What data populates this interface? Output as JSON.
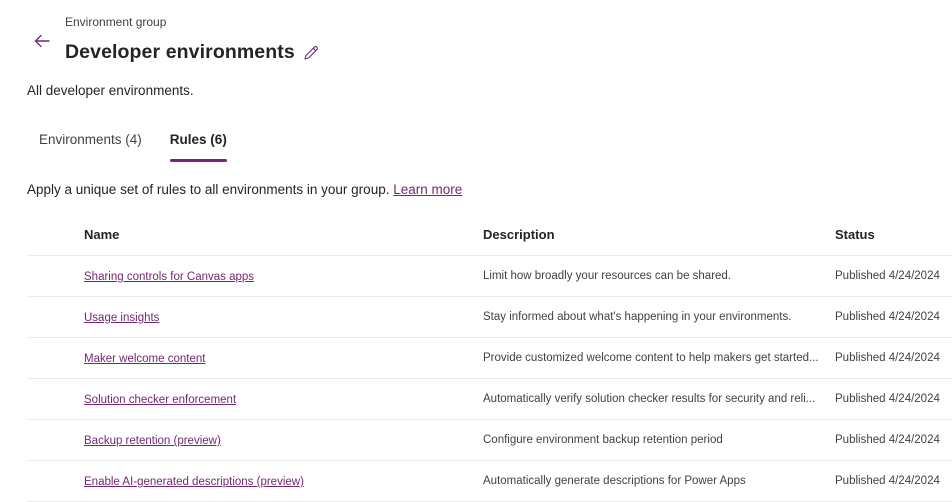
{
  "header": {
    "eyebrow": "Environment group",
    "title": "Developer environments",
    "subtitle": "All developer environments.",
    "back_icon": "arrow-left-icon",
    "edit_icon": "pencil-icon"
  },
  "tabs": [
    {
      "label": "Environments (4)",
      "active": false
    },
    {
      "label": "Rules (6)",
      "active": true
    }
  ],
  "intro": {
    "text": "Apply a unique set of rules to all environments in your group. ",
    "link": "Learn more"
  },
  "table": {
    "columns": [
      "Name",
      "Description",
      "Status"
    ],
    "rows": [
      {
        "name": "Sharing controls for Canvas apps",
        "description": "Limit how broadly your resources can be shared.",
        "status": "Published 4/24/2024"
      },
      {
        "name": "Usage insights",
        "description": "Stay informed about what's happening in your environments.",
        "status": "Published 4/24/2024"
      },
      {
        "name": "Maker welcome content",
        "description": "Provide customized welcome content to help makers get started...",
        "status": "Published 4/24/2024"
      },
      {
        "name": "Solution checker enforcement",
        "description": "Automatically verify solution checker results for security and reli...",
        "status": "Published 4/24/2024"
      },
      {
        "name": "Backup retention (preview)",
        "description": "Configure environment backup retention period",
        "status": "Published 4/24/2024"
      },
      {
        "name": "Enable AI-generated descriptions (preview)",
        "description": "Automatically generate descriptions for Power Apps",
        "status": "Published 4/24/2024"
      }
    ]
  },
  "colors": {
    "accent": "#742774",
    "text": "#242424",
    "secondary_text": "#424242",
    "divider": "#ebebeb"
  }
}
